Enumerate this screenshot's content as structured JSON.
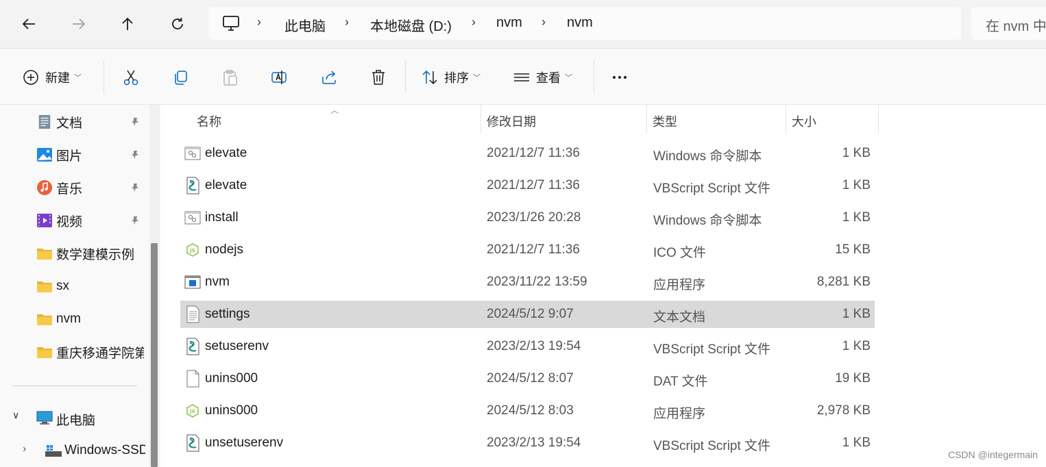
{
  "nav": {
    "back_icon": "arrow-left-icon",
    "forward_icon": "arrow-right-icon",
    "up_icon": "arrow-up-icon",
    "refresh_icon": "refresh-icon"
  },
  "breadcrumb": {
    "root_icon": "computer-icon",
    "items": [
      "此电脑",
      "本地磁盘 (D:)",
      "nvm",
      "nvm"
    ]
  },
  "search": {
    "placeholder": "在 nvm 中"
  },
  "toolbar": {
    "new_label": "新建",
    "sort_label": "排序",
    "view_label": "查看",
    "more_label": "..."
  },
  "sidebar": {
    "quick_items": [
      {
        "label": "文档",
        "icon": "documents-icon",
        "pinned": true
      },
      {
        "label": "图片",
        "icon": "pictures-icon",
        "pinned": true
      },
      {
        "label": "音乐",
        "icon": "music-icon",
        "pinned": true
      },
      {
        "label": "视频",
        "icon": "videos-icon",
        "pinned": true
      },
      {
        "label": "数学建模示例",
        "icon": "folder-icon",
        "pinned": false
      },
      {
        "label": "sx",
        "icon": "folder-icon",
        "pinned": false
      },
      {
        "label": "nvm",
        "icon": "folder-icon",
        "pinned": false
      },
      {
        "label": "重庆移通学院第",
        "icon": "folder-icon",
        "pinned": false
      }
    ],
    "this_pc": "此电脑",
    "drive": "Windows-SSD"
  },
  "columns": {
    "name": "名称",
    "date": "修改日期",
    "type": "类型",
    "size": "大小"
  },
  "files": [
    {
      "name": "elevate",
      "date": "2021/12/7 11:36",
      "type": "Windows 命令脚本",
      "size": "1 KB",
      "icon": "cmd-icon"
    },
    {
      "name": "elevate",
      "date": "2021/12/7 11:36",
      "type": "VBScript Script 文件",
      "size": "1 KB",
      "icon": "vbs-icon"
    },
    {
      "name": "install",
      "date": "2023/1/26 20:28",
      "type": "Windows 命令脚本",
      "size": "1 KB",
      "icon": "cmd-icon"
    },
    {
      "name": "nodejs",
      "date": "2021/12/7 11:36",
      "type": "ICO 文件",
      "size": "15 KB",
      "icon": "nodejs-icon"
    },
    {
      "name": "nvm",
      "date": "2023/11/22 13:59",
      "type": "应用程序",
      "size": "8,281 KB",
      "icon": "exe-icon"
    },
    {
      "name": "settings",
      "date": "2024/5/12 9:07",
      "type": "文本文档",
      "size": "1 KB",
      "icon": "text-file-icon"
    },
    {
      "name": "setuserenv",
      "date": "2023/2/13 19:54",
      "type": "VBScript Script 文件",
      "size": "1 KB",
      "icon": "vbs-icon"
    },
    {
      "name": "unins000",
      "date": "2024/5/12 8:07",
      "type": "DAT 文件",
      "size": "19 KB",
      "icon": "blank-file-icon"
    },
    {
      "name": "unins000",
      "date": "2024/5/12 8:03",
      "type": "应用程序",
      "size": "2,978 KB",
      "icon": "nodejs-icon"
    },
    {
      "name": "unsetuserenv",
      "date": "2023/2/13 19:54",
      "type": "VBScript Script 文件",
      "size": "1 KB",
      "icon": "vbs-icon"
    }
  ],
  "selected_index": 5,
  "watermark": "CSDN @integermain",
  "colors": {
    "selected_row": "#d9d9d9",
    "folder": "#f7c948",
    "accent": "#0067c0"
  }
}
